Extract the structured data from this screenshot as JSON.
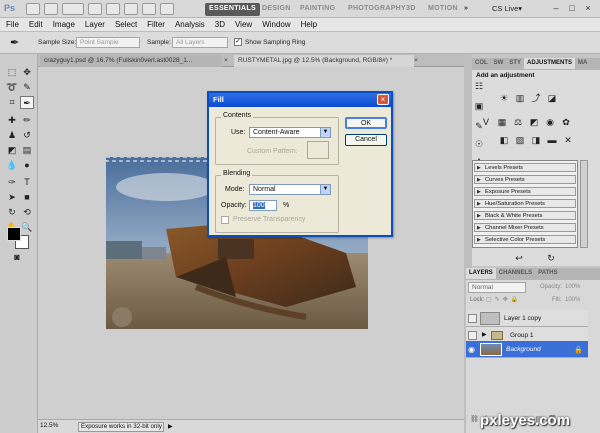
{
  "titlebar": {
    "logo": "Ps",
    "workspaces": [
      "ESSENTIALS",
      "DESIGN",
      "PAINTING",
      "PHOTOGRAPHY",
      "3D",
      "MOTION"
    ],
    "more": "»",
    "cs_live": "CS Live▾",
    "minimize": "–",
    "maximize": "□",
    "close": "×"
  },
  "menu": [
    "File",
    "Edit",
    "Image",
    "Layer",
    "Select",
    "Filter",
    "Analysis",
    "3D",
    "View",
    "Window",
    "Help"
  ],
  "options_bar": {
    "sample_size_label": "Sample Size:",
    "sample_size_value": "Point Sample",
    "sample_label": "Sample:",
    "sample_value": "All Layers",
    "show_ring_label": "Show Sampling Ring",
    "show_ring_checked": "✓"
  },
  "doc_tabs": [
    {
      "label": "crazyguy1.psd @ 16.7% (Fullskin0verl.ast0028_1...",
      "close": "×"
    },
    {
      "label": "RUSTYMETAL.jpg @ 12.5% (Background, RGB/8#) *",
      "close": "×"
    }
  ],
  "status": {
    "zoom": "12.5%",
    "message": "Exposure works in 32-bit only"
  },
  "dialog": {
    "title": "Fill",
    "close": "×",
    "contents_label": "Contents",
    "use_label": "Use:",
    "use_value": "Content-Aware",
    "custom_pattern_label": "Custom Pattern:",
    "blending_label": "Blending",
    "mode_label": "Mode:",
    "mode_value": "Normal",
    "opacity_label": "Opacity:",
    "opacity_value": "100",
    "opacity_unit": "%",
    "preserve_label": "Preserve Transparency",
    "ok": "OK",
    "cancel": "Cancel"
  },
  "adjustments": {
    "tabs": [
      "COL",
      "SW",
      "STY",
      "ADJUSTMENTS",
      "MA"
    ],
    "heading": "Add an adjustment",
    "presets": [
      "Levels Presets",
      "Curves Presets",
      "Exposure Presets",
      "Hue/Saturation Presets",
      "Black & White Presets",
      "Channel Mixer Presets",
      "Selective Color Presets"
    ]
  },
  "layers_panel": {
    "tabs": [
      "LAYERS",
      "CHANNELS",
      "PATHS"
    ],
    "blend_mode": "Normal",
    "opacity_label": "Opacity:",
    "opacity_value": "100%",
    "lock_label": "Lock:",
    "fill_label": "Fill:",
    "fill_value": "100%",
    "layers": [
      {
        "name": "Layer 1 copy",
        "selected": false
      },
      {
        "name": "Group 1",
        "selected": false
      },
      {
        "name": "Background",
        "selected": true
      }
    ]
  },
  "watermark": "pxleyes.com",
  "colors": {
    "accent": "#3a6fd8",
    "dialog_title": "#0b4cd0",
    "selected_layer": "#3a6fd8"
  }
}
